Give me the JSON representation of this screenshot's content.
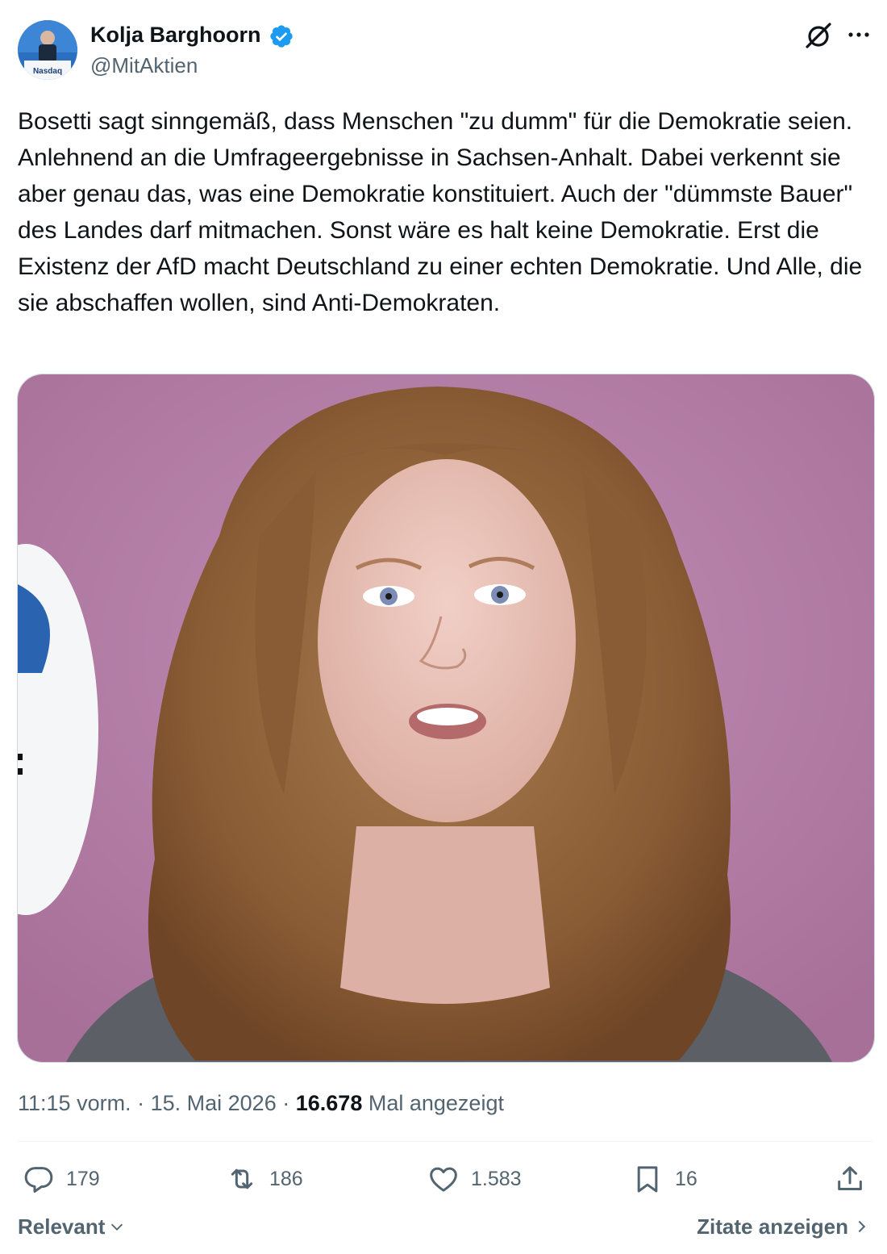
{
  "author": {
    "name": "Kolja Barghoorn",
    "handle": "@MitAktien",
    "avatar_badge_text": "Nasdaq",
    "verified_color": "#1d9bf0"
  },
  "post": {
    "text": "Bosetti sagt sinngemäß, dass Menschen \"zu dumm\" für die Demokratie seien. Anlehnend an die Umfrageergebnisse in Sachsen-Anhalt. Dabei verkennt sie aber genau das, was eine Demokratie konstituiert. Auch der \"dümmste Bauer\" des Landes darf mitmachen. Sonst wäre es halt keine Demokratie. Erst die Existenz der AfD macht Deutschland zu einer echten Demokratie. Und Alle, die sie abschaffen wollen, sind Anti-Demokraten.",
    "time": "11:15 vorm.",
    "separator": "·",
    "date": "15. Mai 2026",
    "views_count": "16.678",
    "views_label": "Mal angezeigt"
  },
  "actions": {
    "replies": "179",
    "reposts": "186",
    "likes": "1.583",
    "bookmarks": "16"
  },
  "footer": {
    "sort_label": "Relevant",
    "quotes_link": "Zitate anzeigen"
  },
  "icons": {
    "verified": "verified-badge-icon",
    "grok": "grok-icon",
    "more": "more-options-icon",
    "reply": "reply-icon",
    "repost": "repost-icon",
    "like": "heart-icon",
    "bookmark": "bookmark-icon",
    "share": "share-icon"
  },
  "colors": {
    "text_primary": "#0f1419",
    "text_secondary": "#536471",
    "accent": "#1d9bf0",
    "media_background": "#b27ea6"
  }
}
